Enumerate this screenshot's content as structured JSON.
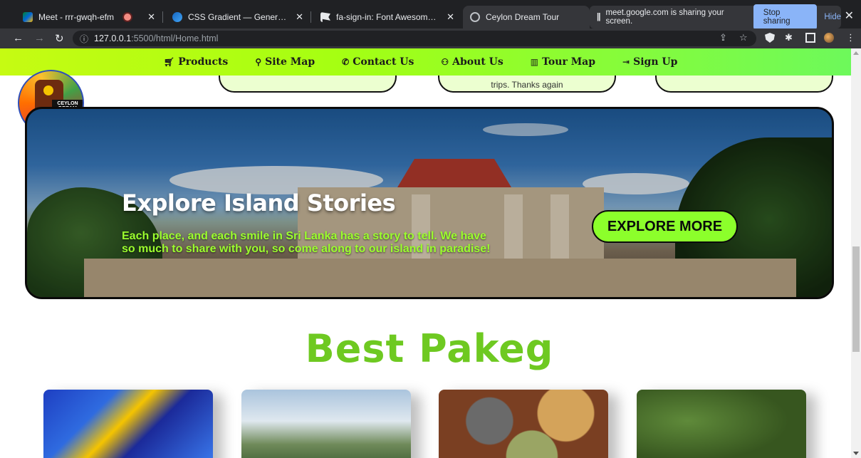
{
  "browser": {
    "tabs": [
      {
        "title": "Meet - rrr-gwqh-efm",
        "icon": "google-meet-icon",
        "recording": true
      },
      {
        "title": "CSS Gradient — Generator, Maker",
        "icon": "css-gradient-icon"
      },
      {
        "title": "fa-sign-in: Font Awesome Icons",
        "icon": "font-awesome-flag-icon"
      },
      {
        "title": "Ceylon Dream Tour",
        "icon": "globe-icon",
        "active": true
      }
    ],
    "share_notice": {
      "text": "meet.google.com is sharing your screen.",
      "stop_label": "Stop sharing",
      "hide_label": "Hide"
    },
    "url_host": "127.0.0.1",
    "url_path": ":5500/html/Home.html"
  },
  "nav": {
    "items": [
      {
        "label": "Products",
        "icon": "cart-icon"
      },
      {
        "label": "Site Map",
        "icon": "sitemap-icon"
      },
      {
        "label": "Contact Us",
        "icon": "phone-icon"
      },
      {
        "label": "About Us",
        "icon": "users-icon"
      },
      {
        "label": "Tour Map",
        "icon": "map-icon"
      },
      {
        "label": "Sign Up",
        "icon": "sign-in-icon"
      }
    ],
    "gradient": [
      "#c6fb12",
      "#6df95b"
    ]
  },
  "reviews_peek": {
    "middle_text": "trips. Thanks again"
  },
  "logo": {
    "text": "CEYLON DREAM TOUR"
  },
  "hero": {
    "title": "Explore Island Stories",
    "text": "Each place, and each smile in Sri Lanka has a story to tell. We have so much to share with you, so come along to our island in paradise!",
    "button_label": "EXPLORE MORE"
  },
  "packages": {
    "title": "Best Pakeg",
    "title_color": "#6ec921",
    "cards": [
      {
        "image": "peacock-mask-image"
      },
      {
        "image": "mountain-image"
      },
      {
        "image": "spices-image"
      },
      {
        "image": "green-hills-image"
      }
    ]
  }
}
